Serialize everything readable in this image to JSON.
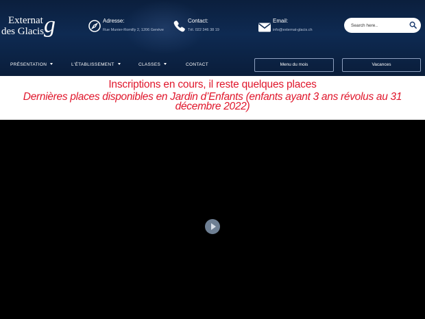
{
  "logo": {
    "line1": "Externat",
    "line2": "des Glacis",
    "mark": "g"
  },
  "contact_info": {
    "address": {
      "label": "Adresse:",
      "value": "Rue Munier-Romilly 2, 1206 Genève",
      "icon": "compass-icon"
    },
    "phone": {
      "label": "Contact:",
      "value": "Tél. 022 346 38 19",
      "icon": "phone-icon"
    },
    "email": {
      "label": "Email:",
      "value": "info@externat-glacis.ch",
      "icon": "envelope-icon"
    }
  },
  "search": {
    "placeholder": "Search here..",
    "icon": "search-icon"
  },
  "nav": {
    "items": [
      {
        "label": "PRÉSENTATION",
        "dropdown": true
      },
      {
        "label": "L'ÉTABLISSEMENT",
        "dropdown": true
      },
      {
        "label": "CLASSES",
        "dropdown": true
      },
      {
        "label": "CONTACT",
        "dropdown": false
      }
    ],
    "buttons": [
      {
        "label": "Menu du mois"
      },
      {
        "label": "Vacances"
      }
    ]
  },
  "banner": {
    "line1": "Inscriptions en cours, il reste quelques places",
    "line2": "Dernières places disponibles en Jardin d’Enfants (enfants ayant 3 ans révolus au 31 décembre 2022)"
  },
  "video": {
    "play_icon": "play-icon"
  },
  "colors": {
    "header_bg": "#0e2a52",
    "banner_text": "#e0162b",
    "video_bg": "#000000",
    "play_button": "#6e7f93"
  }
}
